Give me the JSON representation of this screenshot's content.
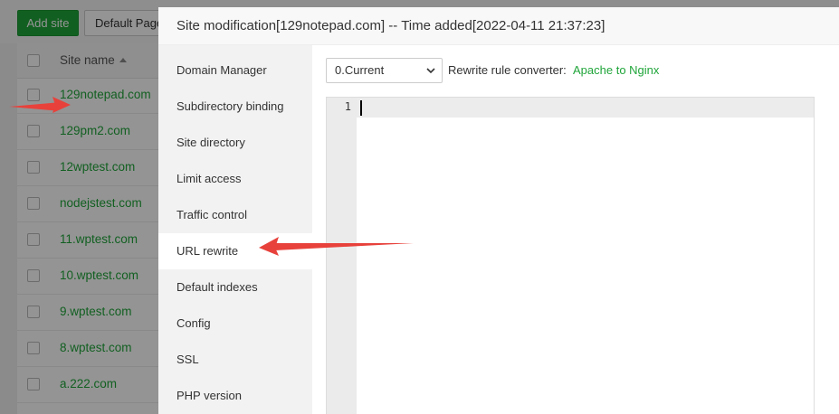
{
  "background": {
    "toolbar": {
      "add_site": "Add site",
      "default_page": "Default Page"
    },
    "table": {
      "header": {
        "site_name": "Site name"
      },
      "rows": [
        "129notepad.com",
        "129pm2.com",
        "12wptest.com",
        "nodejstest.com",
        "11.wptest.com",
        "10.wptest.com",
        "9.wptest.com",
        "8.wptest.com",
        "a.222.com"
      ]
    }
  },
  "modal": {
    "title": "Site modification[129notepad.com] -- Time added[2022-04-11 21:37:23]",
    "menu": [
      "Domain Manager",
      "Subdirectory binding",
      "Site directory",
      "Limit access",
      "Traffic control",
      "URL rewrite",
      "Default indexes",
      "Config",
      "SSL",
      "PHP version"
    ],
    "active_menu": "URL rewrite",
    "rewrite": {
      "select_value": "0.Current",
      "converter_label": "Rewrite rule converter:",
      "converter_link": "Apache to Nginx"
    },
    "editor": {
      "line_numbers": [
        "1"
      ]
    }
  },
  "colors": {
    "accent": "#20a53a",
    "annotation_arrow": "#e8413b"
  }
}
